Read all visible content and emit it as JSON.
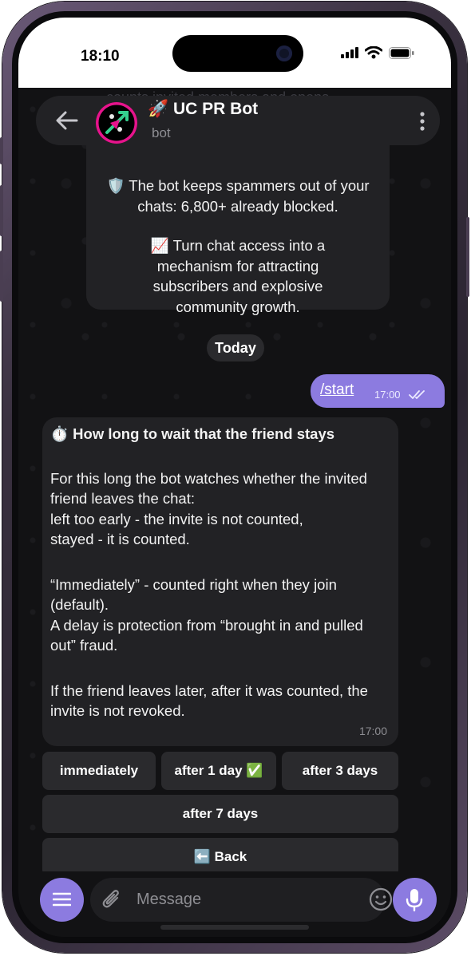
{
  "status_bar": {
    "time": "18:10"
  },
  "background_text": "counts invited members and opens",
  "header": {
    "title": "🚀 UC PR Bot",
    "subtitle": "bot"
  },
  "messages": {
    "intro": {
      "line1": "🛡️ The bot keeps spammers out of your chats: 6,800+ already blocked.",
      "line2": "📈 Turn chat access into a mechanism for attracting subscribers and explosive community growth."
    },
    "date_separator": "Today",
    "outgoing": {
      "text": "/start",
      "time": "17:00"
    },
    "bot_reply": {
      "title": "⏱️ How long to wait that the friend stays",
      "p1": "For this long the bot watches whether the invited friend leaves the chat:",
      "p1b": "left too early - the invite is not counted,",
      "p1c": "stayed - it is counted.",
      "p2": "“Immediately” - counted right when they join (default).",
      "p2b": "A delay is protection from “brought in and pulled out” fraud.",
      "p3": "If the friend leaves later, after it was counted, the invite is not revoked.",
      "time": "17:00"
    }
  },
  "inline_keyboard": {
    "immediately": "immediately",
    "after_1_day": "after 1 day ✅",
    "after_3_days": "after 3 days",
    "after_7_days": "after 7 days",
    "back": "⬅️ Back"
  },
  "input": {
    "placeholder": "Message"
  },
  "colors": {
    "accent": "#8c7be0",
    "bubble": "#222225",
    "background": "#121214"
  },
  "icons": [
    "back-arrow-icon",
    "more-vertical-icon",
    "menu-icon",
    "attach-icon",
    "emoji-icon",
    "microphone-icon",
    "double-check-icon",
    "signal-icon",
    "wifi-icon",
    "battery-icon"
  ]
}
